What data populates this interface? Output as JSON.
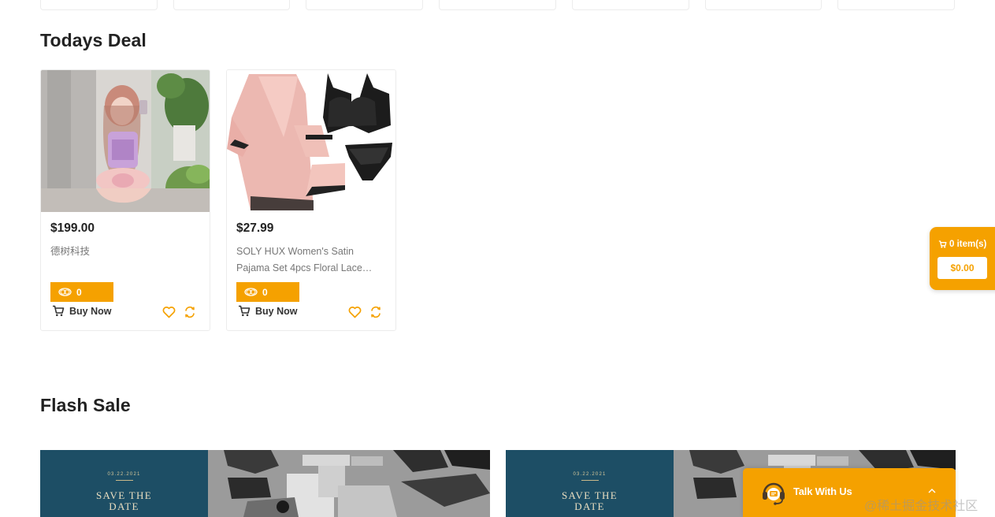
{
  "sections": {
    "todays_deal_title": "Todays Deal",
    "flash_sale_title": "Flash Sale"
  },
  "products": [
    {
      "price": "$199.00",
      "name": "德树科技",
      "points": "0",
      "buy_label": "Buy Now"
    },
    {
      "price": "$27.99",
      "name": "SOLY HUX Women's Satin Pajama Set 4pcs Floral Lace…",
      "points": "0",
      "buy_label": "Buy Now"
    }
  ],
  "side_cart": {
    "items_label": "0 item(s)",
    "total": "$0.00"
  },
  "banners": [
    {
      "date": "03.22.2021",
      "headline_1": "SAVE THE",
      "headline_2": "DATE"
    },
    {
      "date": "03.22.2021",
      "headline_1": "SAVE THE",
      "headline_2": "DATE"
    }
  ],
  "chat": {
    "label": "Talk With Us"
  },
  "watermark": "@稀土掘金技术社区",
  "colors": {
    "accent": "#f5a100",
    "banner_teal": "#1d4e65",
    "text_dark": "#222222",
    "text_muted": "#777777"
  },
  "icons": [
    "coin-icon",
    "cart-icon",
    "heart-icon",
    "compare-icon",
    "headset-icon",
    "chevron-up-icon"
  ]
}
